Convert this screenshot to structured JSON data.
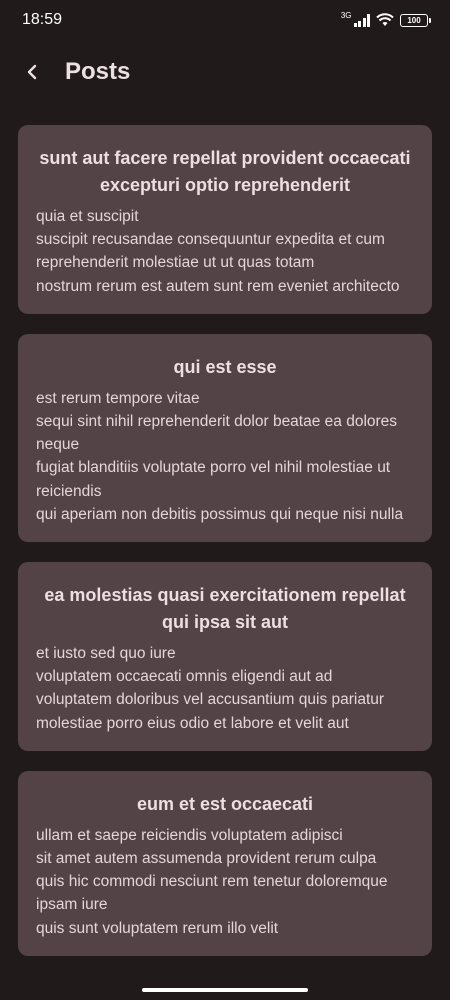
{
  "status_bar": {
    "time": "18:59",
    "network": "3G",
    "battery": "100"
  },
  "app_bar": {
    "title": "Posts",
    "back_icon": "chevron-left-icon"
  },
  "posts": [
    {
      "title": "sunt aut facere repellat provident occaecati excepturi optio reprehenderit",
      "body": "quia et suscipit\nsuscipit recusandae consequuntur expedita et cum reprehenderit molestiae ut ut quas totam\nnostrum rerum est autem sunt rem eveniet architecto"
    },
    {
      "title": "qui est esse",
      "body": "est rerum tempore vitae\nsequi sint nihil reprehenderit dolor beatae ea dolores neque\nfugiat blanditiis voluptate porro vel nihil molestiae ut reiciendis\nqui aperiam non debitis possimus qui neque nisi nulla"
    },
    {
      "title": "ea molestias quasi exercitationem repellat qui ipsa sit aut",
      "body": "et iusto sed quo iure\nvoluptatem occaecati omnis eligendi aut ad\nvoluptatem doloribus vel accusantium quis pariatur\nmolestiae porro eius odio et labore et velit aut"
    },
    {
      "title": "eum et est occaecati",
      "body": "ullam et saepe reiciendis voluptatem adipisci\nsit amet autem assumenda provident rerum culpa\nquis hic commodi nesciunt rem tenetur doloremque ipsam iure\nquis sunt voluptatem rerum illo velit"
    }
  ],
  "colors": {
    "background": "#201a1b",
    "card": "#534246",
    "text": "#e8dedf"
  }
}
